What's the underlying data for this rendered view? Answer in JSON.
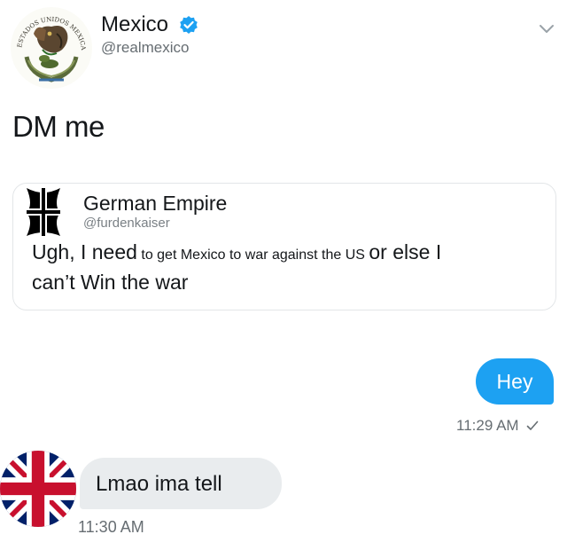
{
  "header": {
    "account_name": "Mexico",
    "handle": "@realmexico",
    "verified_icon": "verified-badge-icon",
    "menu_icon": "chevron-down-icon",
    "seal_text": "ESTADOS UNIDOS MEXICANOS"
  },
  "tweet": {
    "text": "DM me"
  },
  "quoted": {
    "account_name": "German Empire",
    "handle": "@furdenkaiser",
    "line1_part1": "Ugh, I need",
    "line1_part2": " to get Mexico to war against the US",
    "line1_part3": "or else I",
    "line2": "can’t Win the war",
    "avatar_icon": "iron-cross-icon"
  },
  "dm": {
    "outgoing": {
      "text": "Hey",
      "time": "11:29 AM",
      "status_icon": "checkmark-icon"
    },
    "incoming": {
      "text": "Lmao ima tell",
      "time": "11:30 AM",
      "avatar_icon": "union-jack-icon"
    }
  },
  "colors": {
    "accent": "#1da1f2",
    "incoming_bubble": "#e9ecee",
    "secondary_text": "#666d72"
  }
}
